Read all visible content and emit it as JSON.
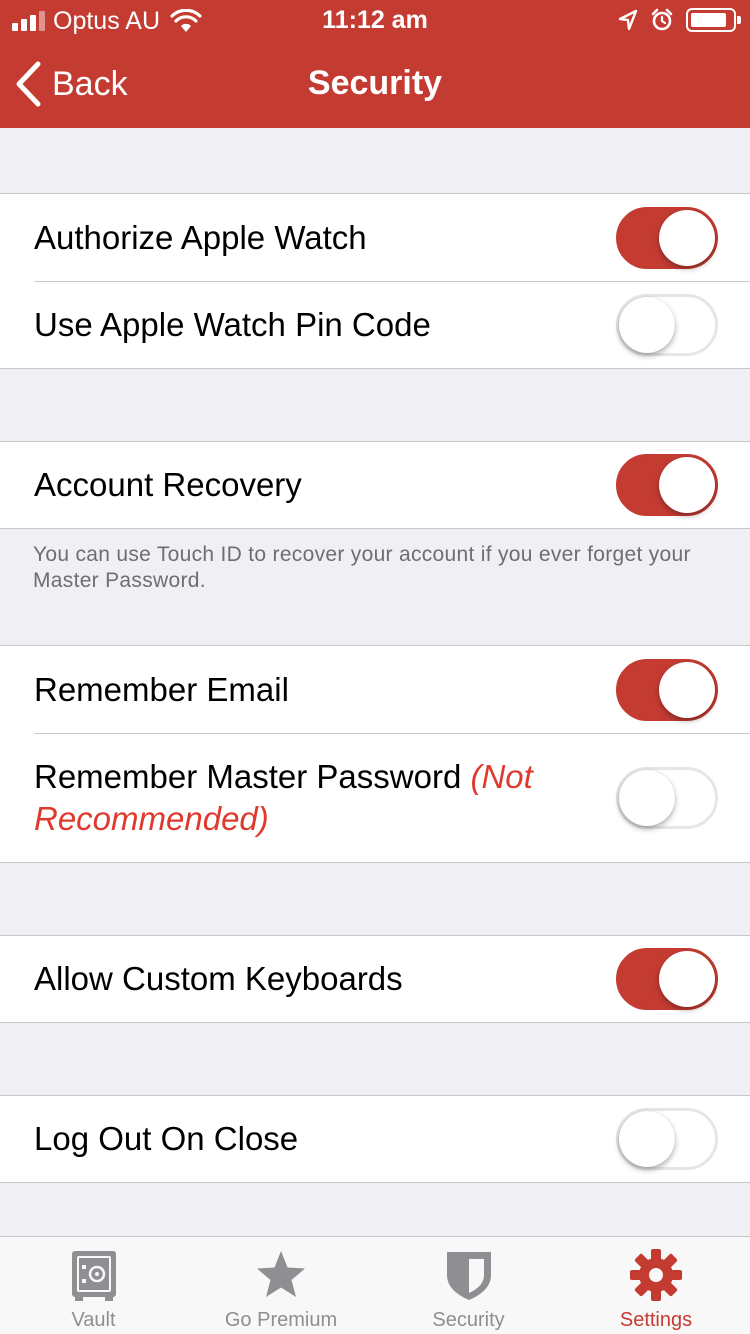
{
  "status_bar": {
    "carrier": "Optus AU",
    "time": "11:12 am",
    "signal_bars_filled": 3,
    "signal_bars_total": 4
  },
  "nav": {
    "back_label": "Back",
    "title": "Security"
  },
  "groups": [
    {
      "rows": [
        {
          "label": "Authorize Apple Watch",
          "on": true
        },
        {
          "label": "Use Apple Watch Pin Code",
          "on": false
        }
      ]
    },
    {
      "rows": [
        {
          "label": "Account Recovery",
          "on": true
        }
      ],
      "footer": "You can use Touch ID to recover your account if you ever forget your Master Password."
    },
    {
      "rows": [
        {
          "label": "Remember Email",
          "on": true
        },
        {
          "label": "Remember Master Password",
          "warning": "(Not Recommended)",
          "on": false
        }
      ]
    },
    {
      "rows": [
        {
          "label": "Allow Custom Keyboards",
          "on": true
        }
      ]
    },
    {
      "rows": [
        {
          "label": "Log Out On Close",
          "on": false
        }
      ]
    }
  ],
  "tabs": [
    {
      "label": "Vault",
      "icon": "vault-icon",
      "active": false
    },
    {
      "label": "Go Premium",
      "icon": "star-icon",
      "active": false
    },
    {
      "label": "Security",
      "icon": "shield-icon",
      "active": false
    },
    {
      "label": "Settings",
      "icon": "gear-icon",
      "active": true
    }
  ],
  "colors": {
    "accent": "#c43b32",
    "warning": "#e0392d",
    "inactive_tab": "#8e8e93"
  }
}
